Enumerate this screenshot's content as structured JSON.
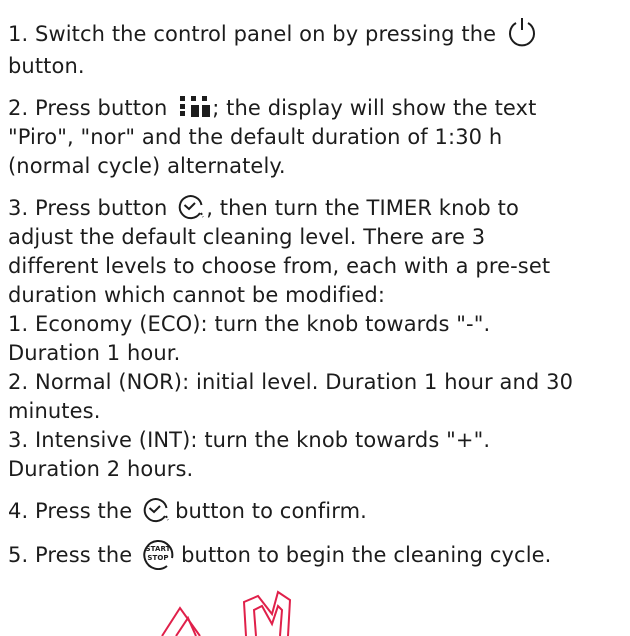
{
  "steps": {
    "step1": {
      "before_icon": "1. Switch the control panel on by pressing the",
      "icon": "power-icon",
      "line2": "button."
    },
    "step2": {
      "before_icon": "2. Press button",
      "icon": "grid-dots-icon",
      "after_icon": "; the display will show the text",
      "line2": "\"Piro\", \"nor\" and the default duration of 1:30 h",
      "line3": "(normal cycle) alternately."
    },
    "step3": {
      "before_icon": "3. Press button",
      "icon": "timer-icon",
      "after_icon": ", then turn the TIMER knob to",
      "line2": "adjust the default cleaning level. There are 3",
      "line3": "different levels to choose from, each with a pre-set",
      "line4": "duration which cannot be modified:",
      "level1_a": "1. Economy (ECO): turn the knob towards \"-\".",
      "level1_b": "Duration 1 hour.",
      "level2_a": "2. Normal (NOR): initial level. Duration 1 hour and 30",
      "level2_b": "minutes.",
      "level3_a": "3. Intensive (INT): turn the knob towards \"+\".",
      "level3_b": "Duration 2 hours."
    },
    "step4": {
      "before_icon": "4. Press the",
      "icon": "timer-icon",
      "after_icon": "button to confirm."
    },
    "step5": {
      "before_icon": "5. Press the",
      "icon": "start-stop-icon",
      "icon_text_top": "START",
      "icon_text_bottom": "STOP",
      "after_icon": "button to begin the cleaning cycle."
    }
  },
  "colors": {
    "text": "#1c1c1c",
    "stamp": "#e0204a"
  }
}
